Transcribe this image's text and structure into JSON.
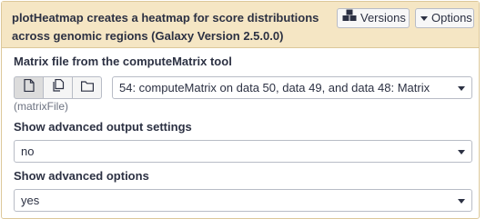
{
  "header": {
    "title": "plotHeatmap creates a heatmap for score distributions across genomic regions (Galaxy Version 2.5.0.0)",
    "versions_label": "Versions",
    "options_label": "Options"
  },
  "icons": {
    "versions": "cubes-icon",
    "options": "caret-down-icon",
    "single_dataset": "file-icon",
    "multiple_datasets": "files-icon",
    "collection": "folder-icon",
    "dropdown": "caret-down-icon"
  },
  "matrix_file": {
    "label": "Matrix file from the computeMatrix tool",
    "value": "54: computeMatrix on data 50, data 49, and data 48: Matrix",
    "help": "(matrixFile)"
  },
  "advanced_output": {
    "label": "Show advanced output settings",
    "value": "no"
  },
  "advanced_options": {
    "label": "Show advanced options",
    "value": "yes"
  },
  "colors": {
    "header_bg": "#f5e6c4",
    "border": "#dcc89a",
    "text": "#2c3143"
  }
}
